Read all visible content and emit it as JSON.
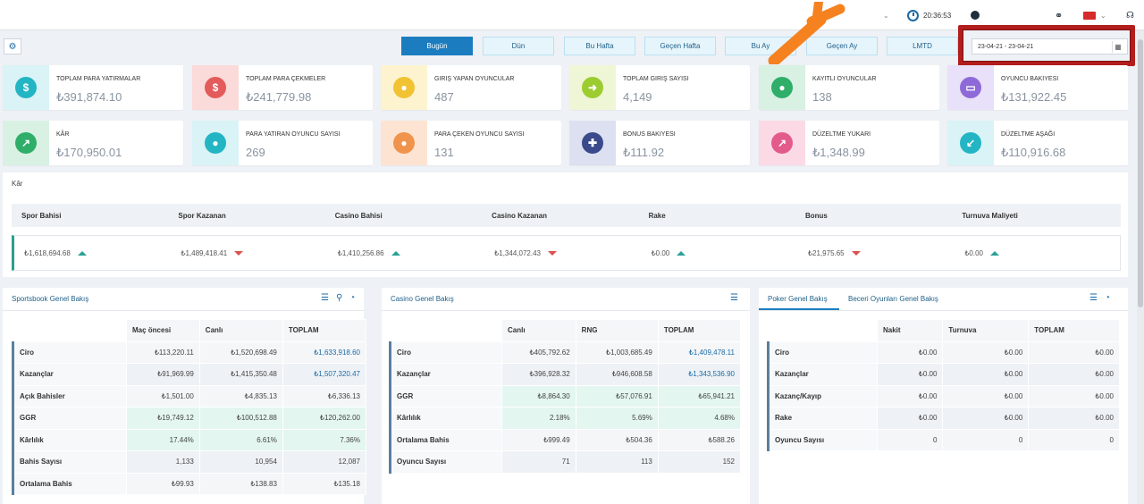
{
  "topbar": {
    "time": "20:36:53"
  },
  "filters": [
    "Bugün",
    "Dün",
    "Bu Hafta",
    "Geçen Hafta",
    "Bu Ay",
    "Geçen Ay",
    "LMTD"
  ],
  "date_range": "23-04-21 - 23-04-21",
  "cards": [
    {
      "label": "TOPLAM PARA YATIRMALAR",
      "value": "₺391,874.10",
      "icon": "dollar-down-icon",
      "color": "#23b5c4",
      "bg": "#d9f3f6"
    },
    {
      "label": "TOPLAM PARA ÇEKMELER",
      "value": "₺241,779.98",
      "icon": "dollar-up-icon",
      "color": "#e35b5b",
      "bg": "#fbdada"
    },
    {
      "label": "GIRIŞ YAPAN OYUNCULAR",
      "value": "487",
      "icon": "user-icon",
      "color": "#f1c232",
      "bg": "#fdf3cf"
    },
    {
      "label": "TOPLAM GIRIŞ SAYISI",
      "value": "4,149",
      "icon": "arrow-right-icon",
      "color": "#9ccc30",
      "bg": "#eef6d6"
    },
    {
      "label": "KAYITLI OYUNCULAR",
      "value": "138",
      "icon": "user-plus-icon",
      "color": "#2fae6a",
      "bg": "#d8f1e3"
    },
    {
      "label": "OYUNCU BAKIYESI",
      "value": "₺131,922.45",
      "icon": "money-icon",
      "color": "#8e6ad8",
      "bg": "#e9e0f9"
    },
    {
      "label": "KÂR",
      "value": "₺170,950.01",
      "icon": "chart-icon",
      "color": "#2fae6a",
      "bg": "#d8f1e3"
    },
    {
      "label": "PARA YATIRAN OYUNCU SAYISI",
      "value": "269",
      "icon": "user-down-icon",
      "color": "#23b5c4",
      "bg": "#d9f3f6"
    },
    {
      "label": "PARA ÇEKEN OYUNCU SAYISI",
      "value": "131",
      "icon": "user-up-icon",
      "color": "#f0944d",
      "bg": "#fde4d2"
    },
    {
      "label": "BONUS BAKIYESI",
      "value": "₺111.92",
      "icon": "gift-icon",
      "color": "#3a4a8a",
      "bg": "#dde0f0"
    },
    {
      "label": "DÜZELTME YUKARI",
      "value": "₺1,348.99",
      "icon": "arrow-up-right-icon",
      "color": "#e35b8b",
      "bg": "#fbdae6"
    },
    {
      "label": "DÜZELTME AŞAĞI",
      "value": "₺110,916.68",
      "icon": "arrow-down-left-icon",
      "color": "#23b5c4",
      "bg": "#d9f3f6"
    }
  ],
  "kar": {
    "title": "Kâr",
    "headers": [
      "Spor Bahisi",
      "Spor Kazanan",
      "Casino Bahisi",
      "Casino Kazanan",
      "Rake",
      "Bonus",
      "Turnuva Maliyeti"
    ],
    "values": [
      {
        "v": "₺1,618,694.68",
        "t": "up"
      },
      {
        "v": "₺1,489,418.41",
        "t": "down"
      },
      {
        "v": "₺1,410,256.86",
        "t": "up"
      },
      {
        "v": "₺1,344,072.43",
        "t": "down"
      },
      {
        "v": "₺0.00",
        "t": "up"
      },
      {
        "v": "₺21,975.65",
        "t": "down"
      },
      {
        "v": "₺0.00",
        "t": "up"
      }
    ]
  },
  "sportsbook": {
    "title": "Sportsbook Genel Bakış",
    "cols": [
      "Maç öncesi",
      "Canlı",
      "TOPLAM"
    ],
    "rows": [
      {
        "n": "Ciro",
        "v": [
          "₺113,220.11",
          "₺1,520,698.49",
          "₺1,633,918.60"
        ],
        "blue": true
      },
      {
        "n": "Kazançlar",
        "v": [
          "₺91,969.99",
          "₺1,415,350.48",
          "₺1,507,320.47"
        ],
        "blue": true
      },
      {
        "n": "Açık Bahisler",
        "v": [
          "₺1,501.00",
          "₺4,835.13",
          "₺6,336.13"
        ]
      },
      {
        "n": "GGR",
        "v": [
          "₺19,749.12",
          "₺100,512.88",
          "₺120,262.00"
        ],
        "hl": true
      },
      {
        "n": "Kârlılık",
        "v": [
          "17.44%",
          "6.61%",
          "7.36%"
        ],
        "hl": true
      },
      {
        "n": "Bahis Sayısı",
        "v": [
          "1,133",
          "10,954",
          "12,087"
        ]
      },
      {
        "n": "Ortalama Bahis",
        "v": [
          "₺99.93",
          "₺138.83",
          "₺135.18"
        ]
      }
    ]
  },
  "casino": {
    "title": "Casino Genel Bakış",
    "cols": [
      "Canlı",
      "RNG",
      "TOPLAM"
    ],
    "rows": [
      {
        "n": "Ciro",
        "v": [
          "₺405,792.62",
          "₺1,003,685.49",
          "₺1,409,478.11"
        ],
        "blue": true
      },
      {
        "n": "Kazançlar",
        "v": [
          "₺396,928.32",
          "₺946,608.58",
          "₺1,343,536.90"
        ],
        "blue": true
      },
      {
        "n": "GGR",
        "v": [
          "₺8,864.30",
          "₺57,076.91",
          "₺65,941.21"
        ],
        "hl": true
      },
      {
        "n": "Kârlılık",
        "v": [
          "2.18%",
          "5.69%",
          "4.68%"
        ],
        "hl": true
      },
      {
        "n": "Ortalama Bahis",
        "v": [
          "₺999.49",
          "₺504.36",
          "₺588.26"
        ]
      },
      {
        "n": "Oyuncu Sayısı",
        "v": [
          "71",
          "113",
          "152"
        ]
      }
    ]
  },
  "poker": {
    "tab1": "Poker Genel Bakış",
    "tab2": "Beceri Oyunları Genel Bakış",
    "cols": [
      "Nakit",
      "Turnuva",
      "TOPLAM"
    ],
    "rows": [
      {
        "n": "Ciro",
        "v": [
          "₺0.00",
          "₺0.00",
          "₺0.00"
        ]
      },
      {
        "n": "Kazançlar",
        "v": [
          "₺0.00",
          "₺0.00",
          "₺0.00"
        ]
      },
      {
        "n": "Kazanç/Kayıp",
        "v": [
          "₺0.00",
          "₺0.00",
          "₺0.00"
        ]
      },
      {
        "n": "Rake",
        "v": [
          "₺0.00",
          "₺0.00",
          "₺0.00"
        ]
      },
      {
        "n": "Oyuncu Sayısı",
        "v": [
          "0",
          "0",
          "0"
        ]
      }
    ]
  }
}
